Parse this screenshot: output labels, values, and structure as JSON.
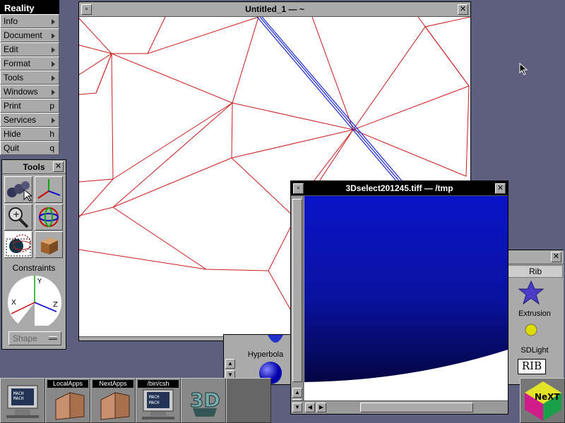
{
  "menu": {
    "title": "Reality",
    "items": [
      {
        "label": "Info",
        "shortcut": "",
        "submenu": true
      },
      {
        "label": "Document",
        "shortcut": "",
        "submenu": true
      },
      {
        "label": "Edit",
        "shortcut": "",
        "submenu": true
      },
      {
        "label": "Format",
        "shortcut": "",
        "submenu": true
      },
      {
        "label": "Tools",
        "shortcut": "",
        "submenu": true
      },
      {
        "label": "Windows",
        "shortcut": "",
        "submenu": true
      },
      {
        "label": "Print",
        "shortcut": "p",
        "submenu": false
      },
      {
        "label": "Services",
        "shortcut": "",
        "submenu": true
      },
      {
        "label": "Hide",
        "shortcut": "h",
        "submenu": false
      },
      {
        "label": "Quit",
        "shortcut": "q",
        "submenu": false
      }
    ]
  },
  "tools_panel": {
    "title": "Tools",
    "tools": [
      "spheres-select-icon",
      "axes-icon",
      "zoom-icon",
      "rotate-icon",
      "lattice-sphere-icon",
      "box-icon"
    ],
    "constraints_label": "Constraints",
    "axes": {
      "x": "X",
      "y": "Y",
      "z": "Z"
    },
    "shape_popup": "Shape"
  },
  "main_window": {
    "title": "Untitled_1  — ~"
  },
  "tiff_window": {
    "title": "3Dselect201245.tiff  —  /tmp"
  },
  "rib_panel": {
    "tab": "Rib",
    "items": [
      "Extrusion",
      "SDLight"
    ],
    "rib_badge": "RIB"
  },
  "hyperbola_panel": {
    "label": "Hyperbola"
  },
  "dock": {
    "items": [
      {
        "name": "workspace",
        "label": ""
      },
      {
        "name": "local-apps",
        "label": "LocalApps"
      },
      {
        "name": "next-apps",
        "label": "NextApps"
      },
      {
        "name": "terminal",
        "label": "/bin/csh"
      },
      {
        "name": "3d-reality",
        "label": ""
      }
    ]
  },
  "colors": {
    "desktop": "#5d5f7e",
    "wireframe": "#cc1a1a",
    "render_blue": "#0a14c8"
  }
}
